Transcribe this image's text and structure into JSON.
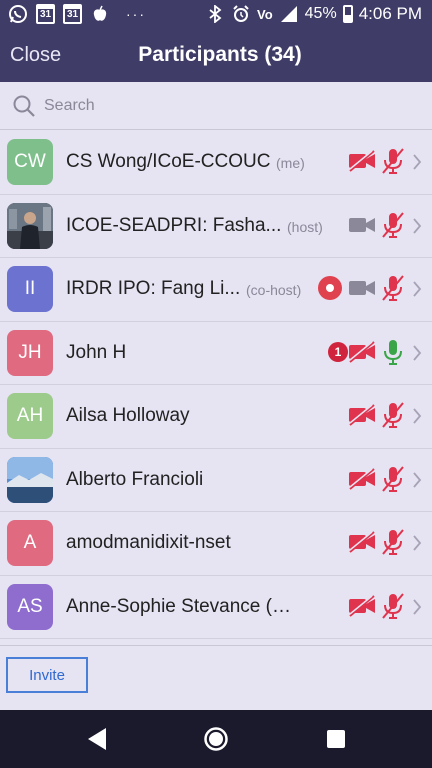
{
  "status_bar": {
    "calendar_day_1": "31",
    "calendar_day_2": "31",
    "battery": "45%",
    "time": "4:06 PM",
    "network": "Vo",
    "icons": [
      "whatsapp-icon",
      "calendar-icon",
      "calendar-icon",
      "apple-icon",
      "more-dots-icon",
      "bluetooth-icon",
      "alarm-icon",
      "volte-icon",
      "signal-icon",
      "battery-icon"
    ]
  },
  "header": {
    "close_label": "Close",
    "title": "Participants (34)"
  },
  "search": {
    "placeholder": "Search"
  },
  "colors": {
    "header_bg": "#3f3d68",
    "list_bg": "#e6e3f2",
    "muted_red": "#e0334d",
    "unmuted_green": "#3aa548",
    "video_grey": "#8a8899",
    "invite_blue": "#2f6ad0"
  },
  "participants": [
    {
      "initials": "CW",
      "name": "CS Wong/ICoE-CCOUC",
      "role": "(me)",
      "avatar_color": "#7fbf8c",
      "video": "off",
      "audio": "muted",
      "recording": false,
      "badge": ""
    },
    {
      "initials": "",
      "name": "ICOE-SEADPRI: Fasha...",
      "role": "(host)",
      "avatar_color": "#2b2f3a",
      "avatar_photo": "person",
      "video": "on",
      "audio": "muted",
      "recording": false,
      "badge": ""
    },
    {
      "initials": "II",
      "name": "IRDR IPO: Fang Li...",
      "role": "(co-host)",
      "avatar_color": "#6b72d0",
      "video": "on",
      "audio": "muted",
      "recording": true,
      "badge": ""
    },
    {
      "initials": "JH",
      "name": "John H",
      "role": "",
      "avatar_color": "#e06a80",
      "video": "off",
      "audio": "unmuted",
      "recording": false,
      "badge": "1"
    },
    {
      "initials": "AH",
      "name": "Ailsa Holloway",
      "role": "",
      "avatar_color": "#9ccb8c",
      "video": "off",
      "audio": "muted",
      "recording": false,
      "badge": ""
    },
    {
      "initials": "",
      "name": "Alberto Francioli",
      "role": "",
      "avatar_color": "#5b7fb3",
      "avatar_photo": "landscape",
      "video": "off",
      "audio": "muted",
      "recording": false,
      "badge": ""
    },
    {
      "initials": "A",
      "name": "amodmanidixit-nset",
      "role": "",
      "avatar_color": "#e06a80",
      "video": "off",
      "audio": "muted",
      "recording": false,
      "badge": ""
    },
    {
      "initials": "AS",
      "name": "Anne-Sophie Stevance (ISC)",
      "role": "",
      "avatar_color": "#8e6dcf",
      "video": "off",
      "audio": "muted",
      "recording": false,
      "badge": ""
    }
  ],
  "footer": {
    "invite_label": "Invite"
  },
  "nav": {
    "icons": [
      "back-icon",
      "home-icon",
      "recents-icon"
    ]
  }
}
